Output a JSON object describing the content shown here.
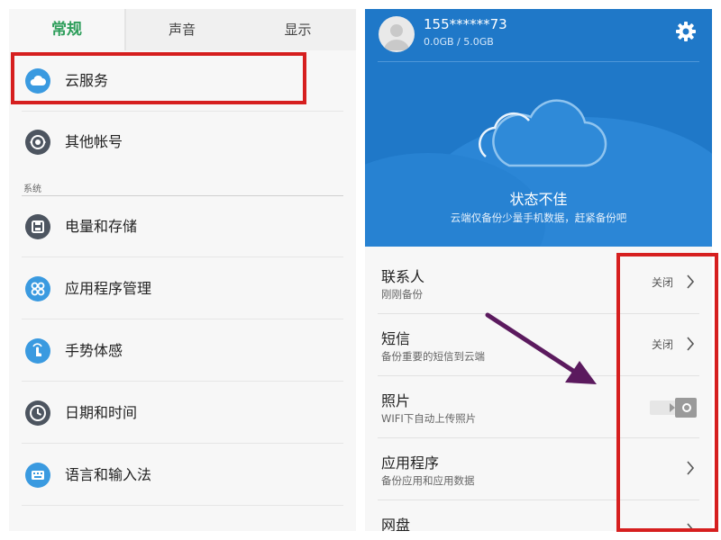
{
  "left": {
    "tabs": [
      {
        "label": "常规",
        "active": true
      },
      {
        "label": "声音",
        "active": false
      },
      {
        "label": "显示",
        "active": false
      }
    ],
    "items_top": [
      {
        "label": "云服务",
        "icon": "cloud-icon"
      },
      {
        "label": "其他帐号",
        "icon": "account-sync-icon"
      }
    ],
    "section_title": "系统",
    "items_system": [
      {
        "label": "电量和存储",
        "icon": "storage-icon"
      },
      {
        "label": "应用程序管理",
        "icon": "apps-icon"
      },
      {
        "label": "手势体感",
        "icon": "gesture-icon"
      },
      {
        "label": "日期和时间",
        "icon": "clock-icon"
      },
      {
        "label": "语言和输入法",
        "icon": "keyboard-icon"
      }
    ]
  },
  "right": {
    "account": "155******73",
    "quota": "0.0GB / 5.0GB",
    "status": "状态不佳",
    "status_sub": "云端仅备份少量手机数据，赶紧备份吧",
    "rows": [
      {
        "title": "联系人",
        "sub": "刚刚备份",
        "state": "关闭"
      },
      {
        "title": "短信",
        "sub": "备份重要的短信到云端",
        "state": "关闭"
      },
      {
        "title": "照片",
        "sub": "WIFI下自动上传照片",
        "state": ""
      },
      {
        "title": "应用程序",
        "sub": "备份应用和应用数据",
        "state": ""
      },
      {
        "title": "网盘",
        "sub": "",
        "state": ""
      }
    ]
  },
  "colors": {
    "accent_green": "#2e9e5b",
    "hero_blue": "#1f78c8",
    "annotation_red": "#d61f1f",
    "annotation_arrow": "#5b1a5e"
  }
}
